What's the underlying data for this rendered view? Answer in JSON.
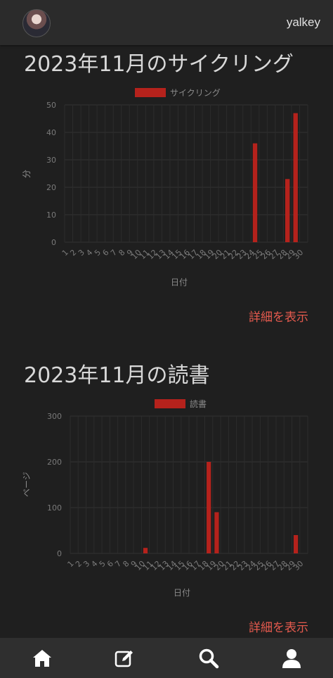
{
  "header": {
    "username": "yalkey"
  },
  "sections": [
    {
      "title": "2023年11月のサイクリング",
      "detail_label": "詳細を表示"
    },
    {
      "title": "2023年11月の読書",
      "detail_label": "詳細を表示"
    }
  ],
  "colors": {
    "bar": "#b5221c",
    "link": "#e55a4e",
    "background": "#1f1f1f",
    "nav": "#2f2f2f"
  },
  "nav": {
    "items": [
      "home-icon",
      "edit-icon",
      "search-icon",
      "user-icon"
    ]
  },
  "chart_data": [
    {
      "type": "bar",
      "legend": "サイクリング",
      "xlabel": "日付",
      "ylabel": "分",
      "ylim": [
        0,
        50
      ],
      "yticks": [
        0,
        10,
        20,
        30,
        40,
        50
      ],
      "categories": [
        1,
        2,
        3,
        4,
        5,
        6,
        7,
        8,
        9,
        10,
        11,
        12,
        13,
        14,
        15,
        16,
        17,
        18,
        19,
        20,
        21,
        22,
        23,
        24,
        25,
        26,
        27,
        28,
        29,
        30
      ],
      "series": [
        {
          "name": "サイクリング",
          "values": [
            0,
            0,
            0,
            0,
            0,
            0,
            0,
            0,
            0,
            0,
            0,
            0,
            0,
            0,
            0,
            0,
            0,
            0,
            0,
            0,
            0,
            0,
            0,
            36,
            0,
            0,
            0,
            23,
            47,
            0
          ]
        }
      ],
      "grid": true,
      "legend_position": "top"
    },
    {
      "type": "bar",
      "legend": "読書",
      "xlabel": "日付",
      "ylabel": "ページ",
      "ylim": [
        0,
        300
      ],
      "yticks": [
        0,
        100,
        200,
        300
      ],
      "categories": [
        1,
        2,
        3,
        4,
        5,
        6,
        7,
        8,
        9,
        10,
        11,
        12,
        13,
        14,
        15,
        16,
        17,
        18,
        19,
        20,
        21,
        22,
        23,
        24,
        25,
        26,
        27,
        28,
        29,
        30
      ],
      "series": [
        {
          "name": "読書",
          "values": [
            0,
            0,
            0,
            0,
            0,
            0,
            0,
            0,
            0,
            12,
            0,
            0,
            0,
            0,
            0,
            0,
            0,
            200,
            90,
            0,
            0,
            0,
            0,
            0,
            0,
            0,
            0,
            0,
            40,
            0
          ]
        }
      ],
      "grid": true,
      "legend_position": "top"
    }
  ]
}
